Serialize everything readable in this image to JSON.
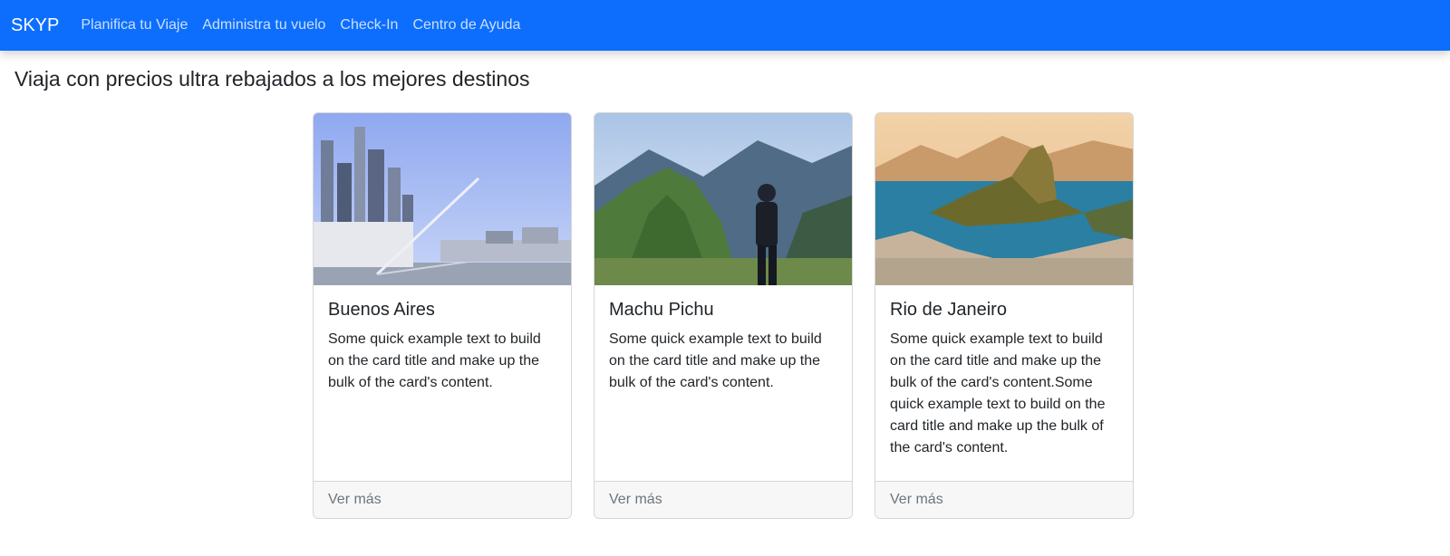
{
  "nav": {
    "brand": "SKYP",
    "links": [
      {
        "label": "Planifica tu Viaje"
      },
      {
        "label": "Administra tu vuelo"
      },
      {
        "label": "Check-In"
      },
      {
        "label": "Centro de Ayuda"
      }
    ]
  },
  "page": {
    "heading": "Viaja con precios ultra rebajados a los mejores destinos"
  },
  "cards": [
    {
      "title": "Buenos Aires",
      "text": "Some quick example text to build on the card title and make up the bulk of the card's content.",
      "footer": "Ver más"
    },
    {
      "title": "Machu Pichu",
      "text": "Some quick example text to build on the card title and make up the bulk of the card's content.",
      "footer": "Ver más"
    },
    {
      "title": "Rio de Janeiro",
      "text": "Some quick example text to build on the card title and make up the bulk of the card's content.Some quick example text to build on the card title and make up the bulk of the card's content.",
      "footer": "Ver más"
    }
  ],
  "colors": {
    "navbar": "#0d6efd",
    "footer_bg": "#f7f7f7"
  }
}
